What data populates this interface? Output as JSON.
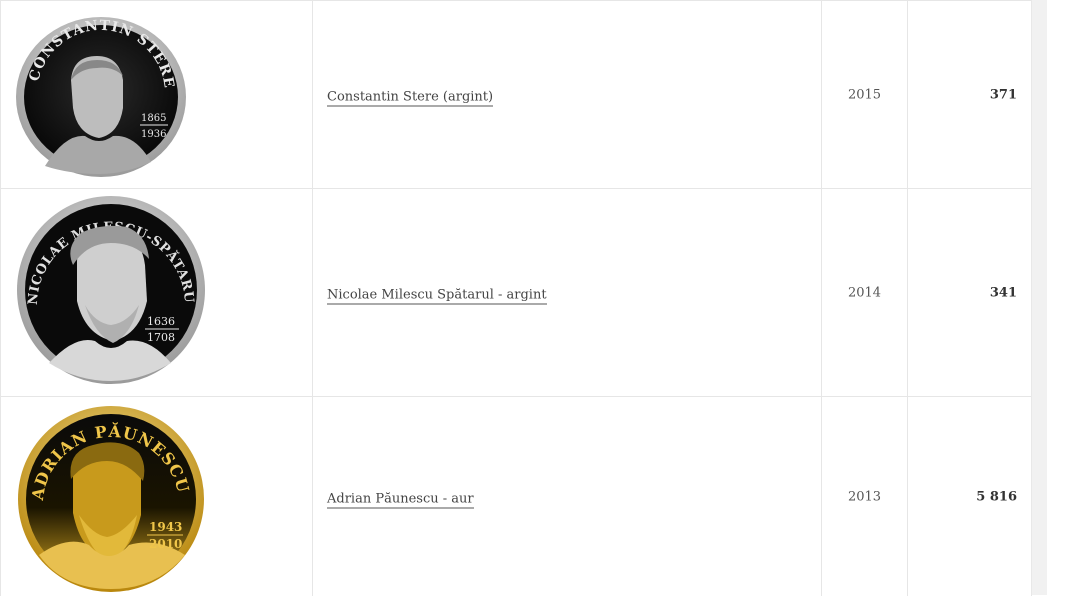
{
  "rows": [
    {
      "coin": {
        "legend": "CONSTANTIN STERE",
        "date_top": "1865",
        "date_bottom": "1936",
        "metal": "silver-dark"
      },
      "name": "Constantin Stere (argint)",
      "year": "2015",
      "price": "371"
    },
    {
      "coin": {
        "legend": "NICOLAE MILESCU-SPĂTARUL",
        "date_top": "1636",
        "date_bottom": "1708",
        "metal": "silver"
      },
      "name": "Nicolae Milescu Spătarul - argint",
      "year": "2014",
      "price": "341"
    },
    {
      "coin": {
        "legend": "ADRIAN PĂUNESCU",
        "date_top": "1943",
        "date_bottom": "2010",
        "metal": "gold"
      },
      "name": "Adrian Păunescu - aur",
      "year": "2013",
      "price": "5 816"
    }
  ],
  "colors": {
    "border": "#e6e6e6",
    "gold": "#d4a520",
    "silver": "#c8c8c8",
    "dark": "#111111"
  }
}
